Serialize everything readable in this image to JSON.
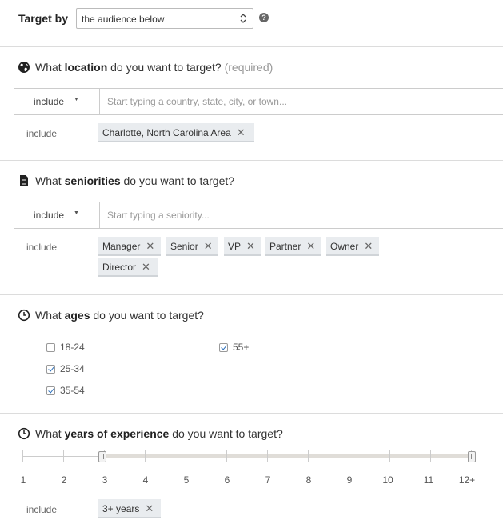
{
  "target": {
    "label": "Target by",
    "select_value": "the audience below",
    "help_icon": "?"
  },
  "location": {
    "icon": "globe-icon",
    "title_pre": "What ",
    "title_bold": "location",
    "title_post": " do you want to target? ",
    "required": "(required)",
    "include_dropdown": "include",
    "placeholder": "Start typing a country, state, city, or town...",
    "include_label": "include",
    "chips": [
      "Charlotte, North Carolina Area"
    ]
  },
  "seniorities": {
    "icon": "document-icon",
    "title_pre": "What ",
    "title_bold": "seniorities",
    "title_post": " do you want to target?",
    "include_dropdown": "include",
    "placeholder": "Start typing a seniority...",
    "include_label": "include",
    "chips": [
      "Manager",
      "Senior",
      "VP",
      "Partner",
      "Owner",
      "Director"
    ]
  },
  "ages": {
    "icon": "clock-icon",
    "title_pre": "What ",
    "title_bold": "ages",
    "title_post": " do you want to target?",
    "options": [
      {
        "label": "18-24",
        "checked": false
      },
      {
        "label": "25-34",
        "checked": true
      },
      {
        "label": "35-54",
        "checked": true
      },
      {
        "label": "55+",
        "checked": true
      }
    ]
  },
  "experience": {
    "icon": "clock-icon",
    "title_pre": "What ",
    "title_bold": "years of experience",
    "title_post": " do you want to target?",
    "tick_labels": [
      "1",
      "2",
      "3",
      "4",
      "5",
      "6",
      "7",
      "8",
      "9",
      "10",
      "11",
      "12+"
    ],
    "range_min": "3",
    "range_max": "12+",
    "include_label": "include",
    "chips": [
      "3+ years"
    ]
  },
  "colors": {
    "check": "#2a6ebb",
    "chip_bg": "#e9ecef",
    "divider": "#dcdcdc"
  }
}
